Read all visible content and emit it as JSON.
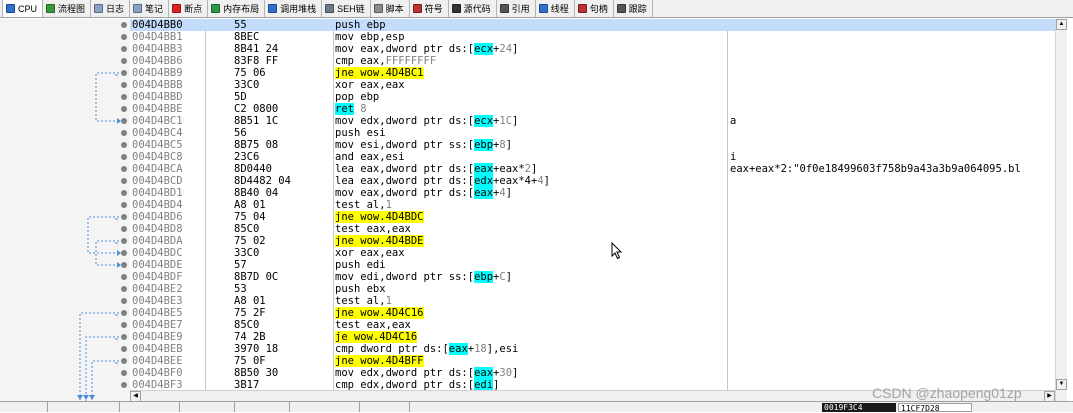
{
  "toolbar": {
    "tabs": [
      {
        "label": "CPU",
        "icon": "cpu-icon",
        "color": "#2f6fd0"
      },
      {
        "label": "流程图",
        "icon": "graph-icon",
        "color": "#3a9a3a"
      },
      {
        "label": "日志",
        "icon": "log-icon",
        "color": "#8aa2c8"
      },
      {
        "label": "笔记",
        "icon": "notes-icon",
        "color": "#8aa2c8"
      },
      {
        "label": "断点",
        "icon": "breakpoint-icon",
        "color": "#e02020"
      },
      {
        "label": "内存布局",
        "icon": "memory-map-icon",
        "color": "#2a9a4a"
      },
      {
        "label": "调用堆栈",
        "icon": "call-stack-icon",
        "color": "#2f6fd0"
      },
      {
        "label": "SEH链",
        "icon": "seh-icon",
        "color": "#6a7a8a"
      },
      {
        "label": "脚本",
        "icon": "script-icon",
        "color": "#8a8a8a"
      },
      {
        "label": "符号",
        "icon": "symbols-icon",
        "color": "#c03030"
      },
      {
        "label": "源代码",
        "icon": "source-icon",
        "color": "#333333"
      },
      {
        "label": "引用",
        "icon": "references-icon",
        "color": "#555555"
      },
      {
        "label": "线程",
        "icon": "threads-icon",
        "color": "#2f6fd0"
      },
      {
        "label": "句柄",
        "icon": "handles-icon",
        "color": "#c03030"
      },
      {
        "label": "跟踪",
        "icon": "trace-icon",
        "color": "#555555"
      }
    ]
  },
  "colors": {
    "jump_highlight": "#ffff00",
    "ret_highlight": "#00ffff",
    "selected_row": "#c4dcfc",
    "address_text": "#808080",
    "branch_arrow": "#4a8fd8",
    "breakpoint_dot": "#808080"
  },
  "disassembly": {
    "rows": [
      {
        "address": "004D4BB0",
        "bytes": "55",
        "instruction": "push ebp",
        "comment": "",
        "selected": true
      },
      {
        "address": "004D4BB1",
        "bytes": "8BEC",
        "instruction": "mov ebp,esp",
        "comment": ""
      },
      {
        "address": "004D4BB3",
        "bytes": "8B41 24",
        "instruction": "mov eax,dword ptr ds:[ecx+24]",
        "comment": ""
      },
      {
        "address": "004D4BB6",
        "bytes": "83F8 FF",
        "instruction": "cmp eax,FFFFFFFF",
        "comment": ""
      },
      {
        "address": "004D4BB9",
        "bytes": "75 06",
        "instruction": "jne wow.4D4BC1",
        "comment": "",
        "jump": true
      },
      {
        "address": "004D4BBB",
        "bytes": "33C0",
        "instruction": "xor eax,eax",
        "comment": ""
      },
      {
        "address": "004D4BBD",
        "bytes": "5D",
        "instruction": "pop ebp",
        "comment": ""
      },
      {
        "address": "004D4BBE",
        "bytes": "C2 0800",
        "instruction": "ret 8",
        "comment": "",
        "ret": true
      },
      {
        "address": "004D4BC1",
        "bytes": "8B51 1C",
        "instruction": "mov edx,dword ptr ds:[ecx+1C]",
        "comment": "a"
      },
      {
        "address": "004D4BC4",
        "bytes": "56",
        "instruction": "push esi",
        "comment": ""
      },
      {
        "address": "004D4BC5",
        "bytes": "8B75 08",
        "instruction": "mov esi,dword ptr ss:[ebp+8]",
        "comment": ""
      },
      {
        "address": "004D4BC8",
        "bytes": "23C6",
        "instruction": "and eax,esi",
        "comment": "i"
      },
      {
        "address": "004D4BCA",
        "bytes": "8D0440",
        "instruction": "lea eax,dword ptr ds:[eax+eax*2]",
        "comment": "eax+eax*2:\"0f0e18499603f758b9a43a3b9a064095.bl"
      },
      {
        "address": "004D4BCD",
        "bytes": "8D4482 04",
        "instruction": "lea eax,dword ptr ds:[edx+eax*4+4]",
        "comment": ""
      },
      {
        "address": "004D4BD1",
        "bytes": "8B40 04",
        "instruction": "mov eax,dword ptr ds:[eax+4]",
        "comment": ""
      },
      {
        "address": "004D4BD4",
        "bytes": "A8 01",
        "instruction": "test al,1",
        "comment": ""
      },
      {
        "address": "004D4BD6",
        "bytes": "75 04",
        "instruction": "jne wow.4D4BDC",
        "comment": "",
        "jump": true
      },
      {
        "address": "004D4BD8",
        "bytes": "85C0",
        "instruction": "test eax,eax",
        "comment": ""
      },
      {
        "address": "004D4BDA",
        "bytes": "75 02",
        "instruction": "jne wow.4D4BDE",
        "comment": "",
        "jump": true
      },
      {
        "address": "004D4BDC",
        "bytes": "33C0",
        "instruction": "xor eax,eax",
        "comment": ""
      },
      {
        "address": "004D4BDE",
        "bytes": "57",
        "instruction": "push edi",
        "comment": ""
      },
      {
        "address": "004D4BDF",
        "bytes": "8B7D 0C",
        "instruction": "mov edi,dword ptr ss:[ebp+C]",
        "comment": ""
      },
      {
        "address": "004D4BE2",
        "bytes": "53",
        "instruction": "push ebx",
        "comment": ""
      },
      {
        "address": "004D4BE3",
        "bytes": "A8 01",
        "instruction": "test al,1",
        "comment": ""
      },
      {
        "address": "004D4BE5",
        "bytes": "75 2F",
        "instruction": "jne wow.4D4C16",
        "comment": "",
        "jump": true
      },
      {
        "address": "004D4BE7",
        "bytes": "85C0",
        "instruction": "test eax,eax",
        "comment": ""
      },
      {
        "address": "004D4BE9",
        "bytes": "74 2B",
        "instruction": "je wow.4D4C16",
        "comment": "",
        "jump": true
      },
      {
        "address": "004D4BEB",
        "bytes": "3970 18",
        "instruction": "cmp dword ptr ds:[eax+18],esi",
        "comment": ""
      },
      {
        "address": "004D4BEE",
        "bytes": "75 0F",
        "instruction": "jne wow.4D4BFF",
        "comment": "",
        "jump": true
      },
      {
        "address": "004D4BF0",
        "bytes": "8B50 30",
        "instruction": "mov edx,dword ptr ds:[eax+30]",
        "comment": ""
      },
      {
        "address": "004D4BF3",
        "bytes": "3B17",
        "instruction": "cmp edx,dword ptr ds:[edi]",
        "comment": ""
      }
    ]
  },
  "watermark": "CSDN @zhaopeng01zp",
  "statusbar": {
    "box1": "0019F3C4",
    "box2": "11CF7D28"
  }
}
